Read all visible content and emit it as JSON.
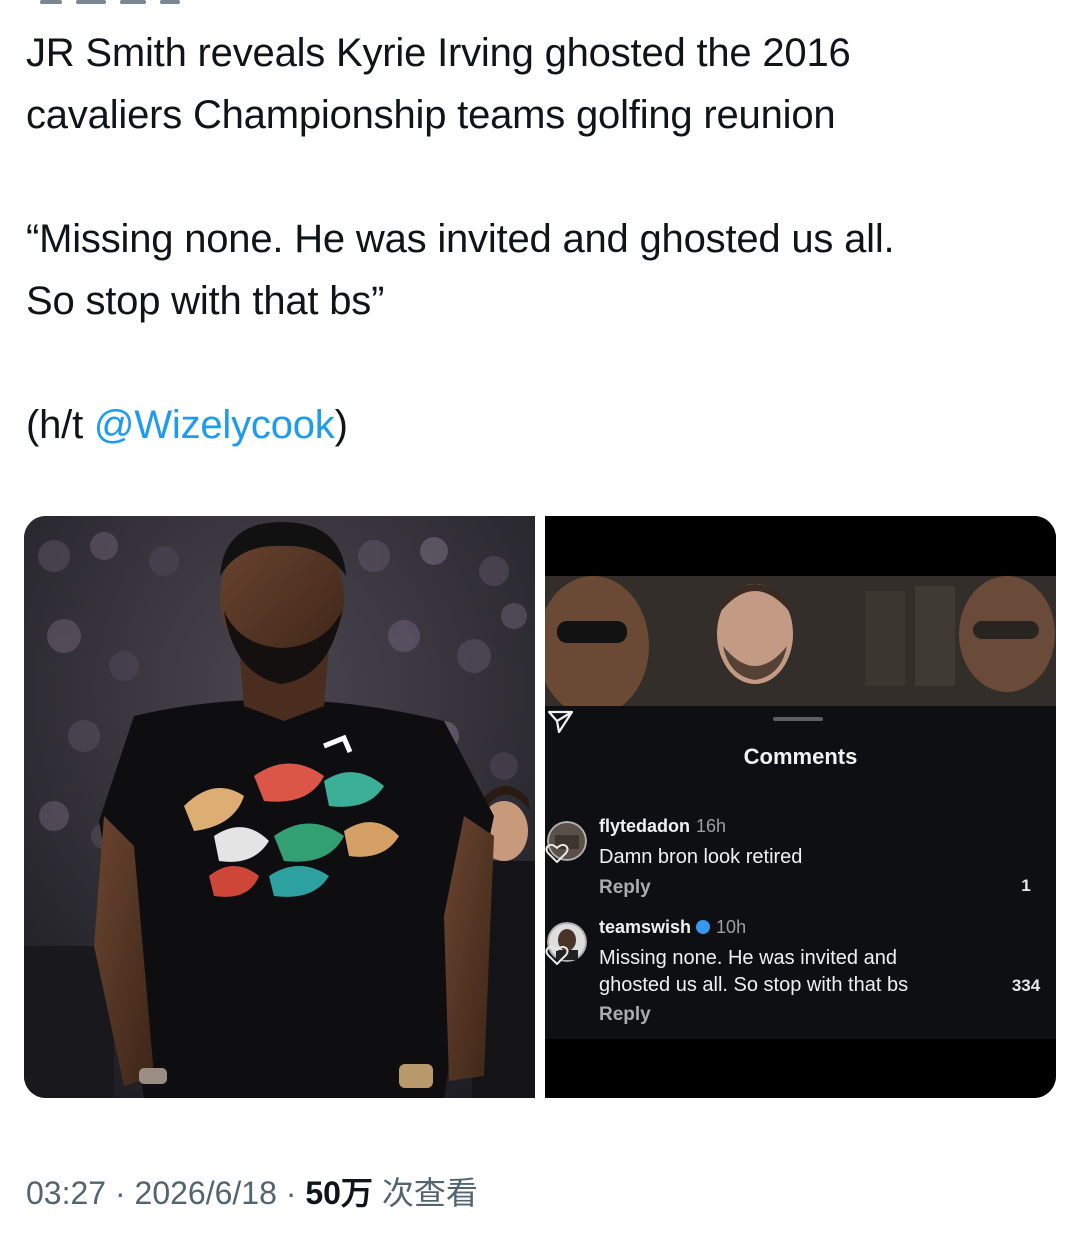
{
  "tweet": {
    "headline_line1": "JR Smith reveals Kyrie Irving ghosted the 2016",
    "headline_line2": "cavaliers Championship teams golfing reunion",
    "quote_line1": "“Missing none. He was invited and ghosted us all.",
    "quote_line2": "So stop with that bs”",
    "ht_prefix": "(h/t ",
    "ht_mention": "@Wizelycook",
    "ht_suffix": ")"
  },
  "media": {
    "left_photo_icon": "player-photo",
    "instagram": {
      "title": "Comments",
      "send_icon": "send-icon",
      "comments": [
        {
          "username": "flytedadon",
          "time": "16h",
          "verified": false,
          "text": "Damn bron look retired",
          "reply_label": "Reply",
          "likes": "1"
        },
        {
          "username": "teamswish",
          "time": "10h",
          "verified": true,
          "text_line1": "Missing none. He was invited and",
          "text_line2": "ghosted us all. So stop with that bs",
          "reply_label": "Reply",
          "likes": "334"
        }
      ]
    }
  },
  "meta": {
    "time": "03:27",
    "sep1": " · ",
    "date": "2026/6/18",
    "sep2": " · ",
    "views_count": "50万",
    "views_label": " 次查看"
  },
  "colors": {
    "text": "#0f1419",
    "muted": "#536471",
    "link": "#1d9bf0",
    "ig_bg": "#0d0f12",
    "verified": "#3897f0"
  }
}
